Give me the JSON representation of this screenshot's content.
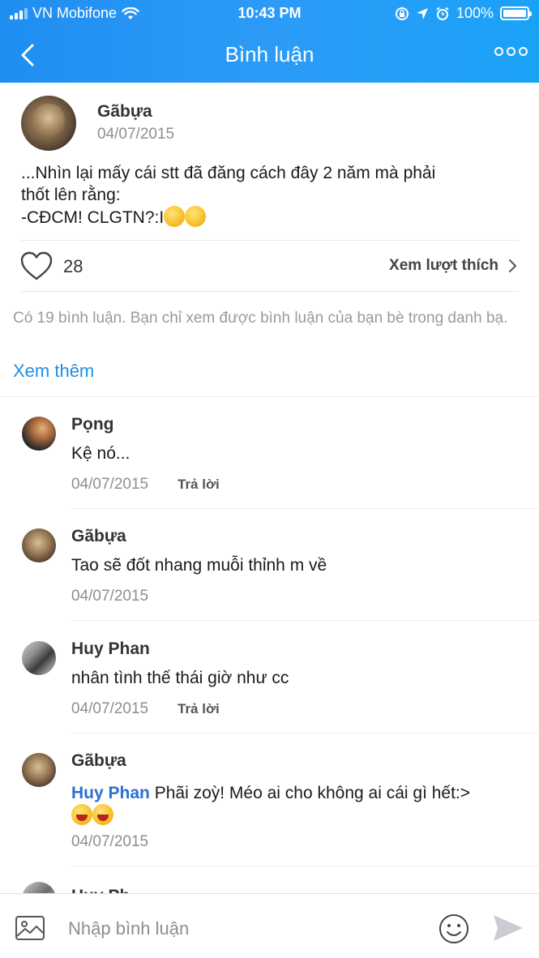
{
  "status_bar": {
    "carrier": "VN Mobifone",
    "time": "10:43 PM",
    "battery": "100%"
  },
  "nav": {
    "title": "Bình luận"
  },
  "post": {
    "author": "Gãbựa",
    "date": "04/07/2015",
    "text_line1": "...Nhìn lại mấy cái stt đã đăng cách đây 2 năm mà phải",
    "text_line2": "thốt lên rằng:",
    "text_line3": "-CĐCM! CLGTN?:I",
    "like_count": "28",
    "view_likes_label": "Xem lượt thích"
  },
  "comments_info": {
    "text": "Có 19 bình luận. Bạn chỉ xem được bình luận của bạn bè trong danh bạ.",
    "see_more": "Xem thêm"
  },
  "comments": [
    {
      "author": "Pọng",
      "text": "Kệ nó...",
      "date": "04/07/2015",
      "reply": "Trả lời"
    },
    {
      "author": "Gãbựa",
      "text": "Tao sẽ đốt nhang muỗi thỉnh m về",
      "date": "04/07/2015"
    },
    {
      "author": "Huy Phan",
      "text": "nhân tình thế thái giờ như cc",
      "date": "04/07/2015",
      "reply": "Trả lời"
    },
    {
      "author": "Gãbựa",
      "mention": "Huy Phan",
      "text": "Phãi zoỳ! Méo ai cho không ai cái gì hết:>",
      "date": "04/07/2015"
    }
  ],
  "partial_comment": {
    "author": "Huy Ph"
  },
  "input": {
    "placeholder": "Nhập bình luận"
  },
  "colors": {
    "header_start": "#1f8ef1",
    "header_end": "#1aa2f6",
    "link_blue": "#1e8ee6",
    "mention_blue": "#2b6fd6"
  },
  "icons": [
    "back-chevron-icon",
    "more-dots-icon",
    "heart-icon",
    "chevron-right-icon",
    "image-icon",
    "smile-icon",
    "send-icon",
    "wifi-icon",
    "location-icon",
    "alarm-icon",
    "rotation-lock-icon"
  ]
}
